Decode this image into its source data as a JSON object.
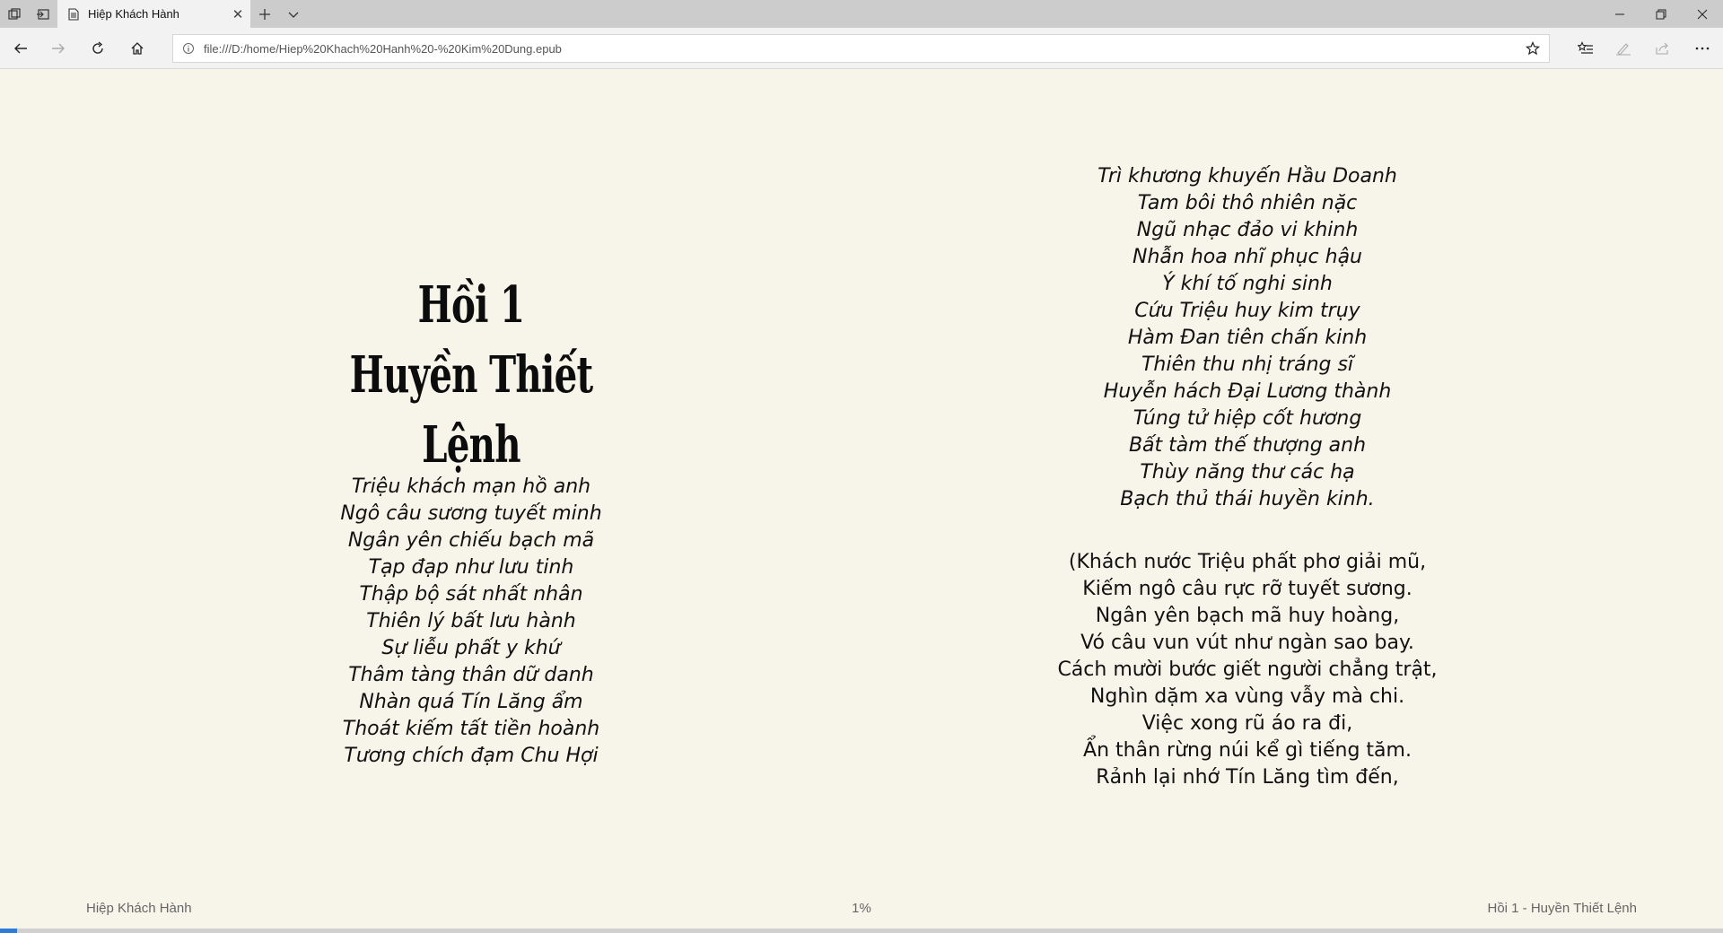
{
  "browser": {
    "tab": {
      "title": "Hiệp Khách Hành"
    },
    "url": "file:///D:/home/Hiep%20Khach%20Hanh%20-%20Kim%20Dung.epub"
  },
  "book": {
    "chapter_number": "Hồi 1",
    "chapter_title": "Huyền Thiết Lệnh",
    "poem_left": [
      "Triệu khách mạn hồ anh",
      "Ngô câu sương tuyết minh",
      "Ngân yên chiếu bạch mã",
      "Tạp đạp như lưu tinh",
      "Thập bộ sát nhất nhân",
      "Thiên lý bất lưu hành",
      "Sự liễu phất y khứ",
      "Thâm tàng thân dữ danh",
      "Nhàn quá Tín Lăng ẩm",
      "Thoát kiếm tất tiền hoành",
      "Tương chích đạm Chu Hợi"
    ],
    "poem_right": [
      "Trì khương khuyến Hầu Doanh",
      "Tam bôi thô nhiên nặc",
      "Ngũ nhạc đảo vi khinh",
      "Nhẫn hoa nhĩ phục hậu",
      "Ý khí tố nghi sinh",
      "Cứu Triệu huy kim trụy",
      "Hàm Đan tiên chấn kinh",
      "Thiên thu nhị tráng sĩ",
      "Huyễn hách Đại Lương thành",
      "Túng tử hiệp cốt hương",
      "Bất tàm thế thượng anh",
      "Thùy năng thư các hạ",
      "Bạch thủ thái huyền kinh."
    ],
    "translation": [
      "(Khách nước Triệu phất phơ giải mũ,",
      "Kiếm ngô câu rực rỡ tuyết sương.",
      "Ngân yên bạch mã huy hoàng,",
      "Vó câu vun vút như ngàn sao bay.",
      "Cách mười bước giết người chẳng trật,",
      "Nghìn dặm xa vùng vẫy mà chi.",
      "Việc xong rũ áo ra đi,",
      "Ẩn thân rừng núi kể gì tiếng tăm.",
      "Rảnh lại nhớ Tín Lăng tìm đến,"
    ]
  },
  "footer": {
    "left": "Hiệp Khách Hành",
    "center": "1%",
    "right": "Hồi 1 - Huyền Thiết Lệnh"
  },
  "progress": {
    "percent": 1
  },
  "icons": [
    "tab-manager-icon",
    "set-aside-tabs-icon",
    "page-icon",
    "close-icon",
    "plus-icon",
    "chevron-down-icon",
    "minimize-icon",
    "restore-icon",
    "close-window-icon",
    "back-icon",
    "forward-icon",
    "refresh-icon",
    "home-icon",
    "info-icon",
    "star-icon",
    "favorites-icon",
    "pen-icon",
    "share-icon",
    "more-icon"
  ],
  "colors": {
    "page_bg": "#f7f4e9",
    "progress": "#2f7bd8"
  }
}
